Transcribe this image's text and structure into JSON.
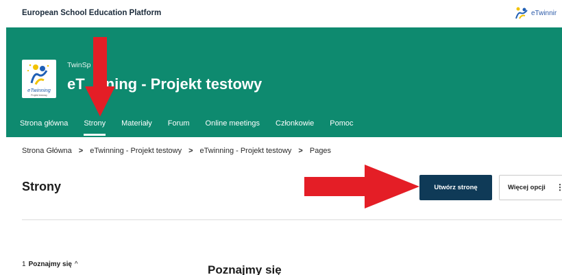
{
  "header": {
    "platform_name": "European School Education Platform",
    "logo_text": "eTwinnir",
    "brand_color": "#0e8a6f"
  },
  "project": {
    "kind": "TwinSp",
    "title_prefix": "eT",
    "title_suffix": "ning - Projekt testowy",
    "logo_caption": "eTwinning",
    "logo_subcaption": "Projekt testowy"
  },
  "nav": {
    "items": [
      {
        "label": "Strona główna",
        "active": false
      },
      {
        "label": "Strony",
        "active": true
      },
      {
        "label": "Materiały",
        "active": false
      },
      {
        "label": "Forum",
        "active": false
      },
      {
        "label": "Online meetings",
        "active": false
      },
      {
        "label": "Członkowie",
        "active": false
      },
      {
        "label": "Pomoc",
        "active": false
      }
    ]
  },
  "breadcrumb": {
    "items": [
      "Strona Główna",
      "eTwinning - Projekt testowy",
      "eTwinning - Projekt testowy",
      "Pages"
    ],
    "separator": ">"
  },
  "page": {
    "title": "Strony",
    "create_button": "Utwórz stronę",
    "more_button": "Więcej opcji",
    "more_icon": "⋮"
  },
  "toc": {
    "items": [
      {
        "number": "1",
        "label": "Poznajmy się",
        "icon": "chevron-up-icon",
        "glyph": "^"
      }
    ]
  },
  "content": {
    "section_title": "Poznajmy się"
  },
  "annotations": {
    "arrow_color": "#e41e26"
  }
}
